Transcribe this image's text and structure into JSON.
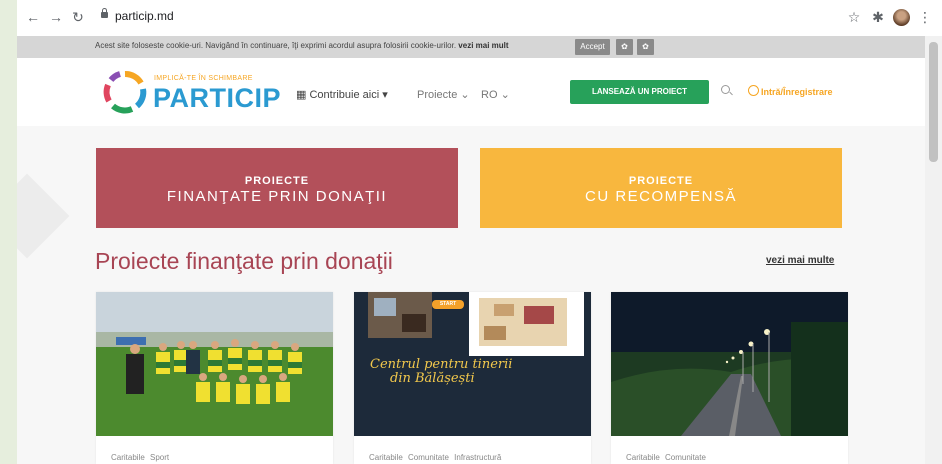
{
  "browser": {
    "url": "particip.md"
  },
  "cookie_bar": {
    "message": "Acest site foloseste cookie-uri. Navigând în continuare, îţi exprimi acordul asupra folosirii cookie-urilor.",
    "more_link": "vezi mai mult",
    "accept_label": "Accept"
  },
  "header": {
    "logo_tagline": "IMPLICĂ-TE ÎN SCHIMBARE",
    "logo_name": "PARTICIP",
    "nav": {
      "contribute": "Contribuie aici",
      "projects": "Proiecte",
      "language": "RO"
    },
    "launch_button": "LANSEAZĂ UN PROIECT",
    "login": "Intră/Înregistrare"
  },
  "categories": [
    {
      "top": "PROIECTE",
      "bottom": "FINANŢATE PRIN DONAŢII",
      "color": "#b3505a"
    },
    {
      "top": "PROIECTE",
      "bottom": "CU RECOMPENSĂ",
      "color": "#f8b73e"
    }
  ],
  "section": {
    "title": "Proiecte finanţate prin donaţii",
    "see_more": "vezi mai multe"
  },
  "projects": [
    {
      "tags": "Caritabile Sport"
    },
    {
      "tags": "Caritabile Comunitate Infrastructură",
      "image_caption": [
        "Centrul pentru tinerii",
        "din Bălășești"
      ],
      "badge": "START"
    },
    {
      "tags": "Caritabile Comunitate"
    }
  ],
  "colors": {
    "accent_green": "#27a15a",
    "accent_orange": "#f6a623",
    "brand_blue": "#2b9ad1",
    "title_red": "#a84554"
  }
}
